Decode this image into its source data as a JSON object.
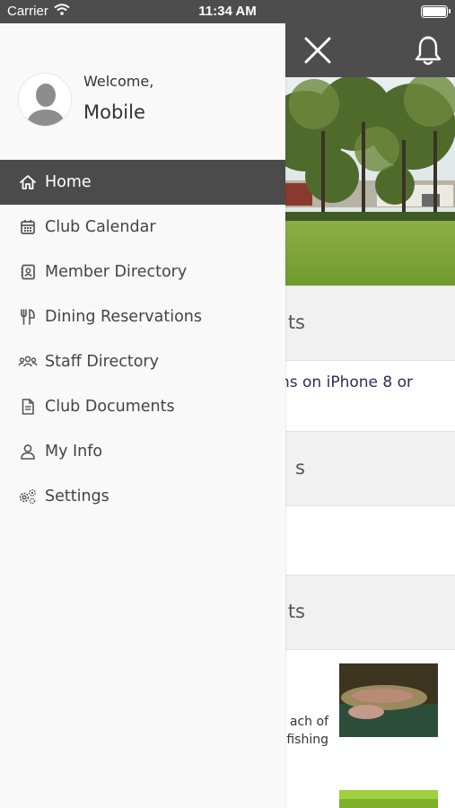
{
  "status_bar": {
    "carrier": "Carrier",
    "time": "11:34 AM",
    "battery_level": 1.0
  },
  "drawer": {
    "welcome": "Welcome,",
    "username": "Mobile",
    "items": [
      {
        "label": "Home",
        "icon": "home-icon",
        "active": true
      },
      {
        "label": "Club Calendar",
        "icon": "calendar-icon",
        "active": false
      },
      {
        "label": "Member Directory",
        "icon": "contact-card-icon",
        "active": false
      },
      {
        "label": "Dining Reservations",
        "icon": "utensils-icon",
        "active": false
      },
      {
        "label": "Staff Directory",
        "icon": "people-group-icon",
        "active": false
      },
      {
        "label": "Club Documents",
        "icon": "document-icon",
        "active": false
      },
      {
        "label": "My Info",
        "icon": "user-icon",
        "active": false
      },
      {
        "label": "Settings",
        "icon": "gears-icon",
        "active": false
      }
    ]
  },
  "background": {
    "sections": [
      {
        "heading_fragment": "ts"
      },
      {
        "heading_fragment": "s"
      },
      {
        "heading_fragment": "ts"
      }
    ],
    "notice_fragment": "ns on iPhone 8 or",
    "news_fragment_line1": "ach of",
    "news_fragment_line2": "fishing"
  },
  "colors": {
    "header": "#4d4d4d",
    "active_item": "#4b4b4b",
    "notice_text": "#2a2e5a"
  }
}
